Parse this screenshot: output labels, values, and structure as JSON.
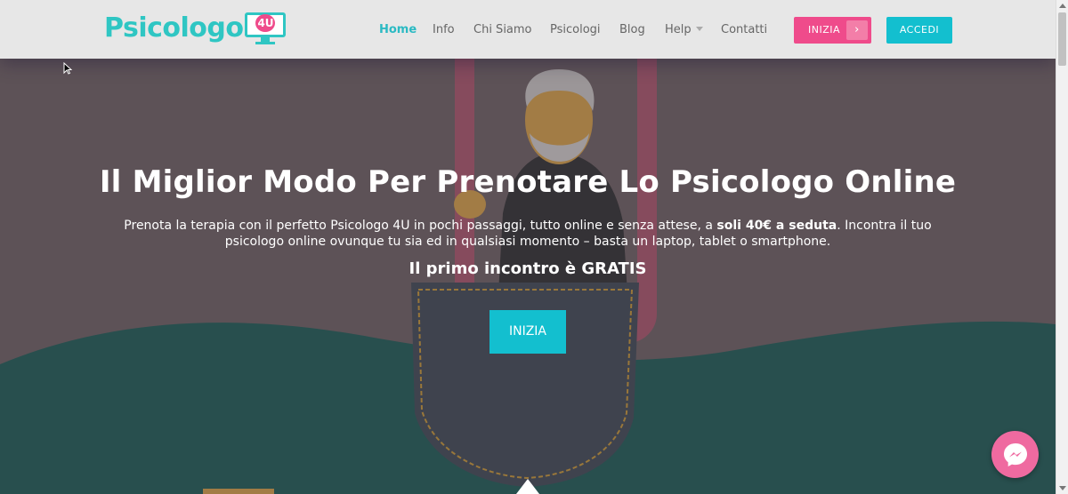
{
  "logo": {
    "text": "Psicologo",
    "badge": "4U"
  },
  "nav": {
    "items": [
      {
        "label": "Home",
        "active": true
      },
      {
        "label": "Info"
      },
      {
        "label": "Chi Siamo"
      },
      {
        "label": "Psicologi"
      },
      {
        "label": "Blog"
      },
      {
        "label": "Help",
        "has_dropdown": true
      },
      {
        "label": "Contatti"
      }
    ],
    "cta_primary": "INIZIA",
    "cta_secondary": "ACCEDI"
  },
  "hero": {
    "title": "Il Miglior Modo Per Prenotare Lo Psicologo Online",
    "desc_part1": "Prenota la terapia con il perfetto Psicologo 4U in pochi passaggi, tutto online e senza attese, a ",
    "desc_bold": "soli 40€ a seduta",
    "desc_part2": ". Incontra il tuo psicologo online ovunque tu sia ed in qualsiasi momento – basta un laptop, tablet o smartphone.",
    "subtitle": "Il primo incontro è GRATIS",
    "button": "INIZIA"
  },
  "icons": {
    "arrow": "chevron-right-icon",
    "caret": "caret-down-icon",
    "chat": "messenger-icon"
  },
  "colors": {
    "brand_teal": "#2fc6c3",
    "accent_pink": "#ef4b8b",
    "button_cyan": "#13bfcf",
    "wave_teal": "#1a5c58"
  }
}
